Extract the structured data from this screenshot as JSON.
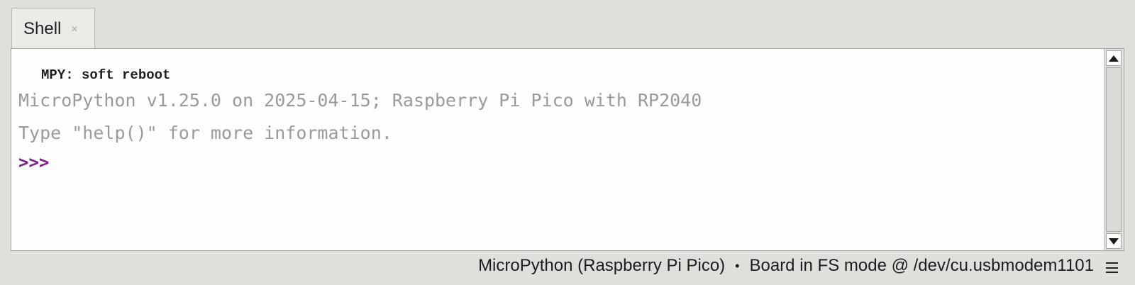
{
  "tabs": [
    {
      "label": "Shell",
      "close_glyph": "×",
      "active": true
    }
  ],
  "shell": {
    "lines": [
      "MPY: soft reboot",
      "MicroPython v1.25.0 on 2025-04-15; Raspberry Pi Pico with RP2040",
      "Type \"help()\" for more information."
    ],
    "prompt": ">>>"
  },
  "status": {
    "interpreter": "MicroPython (Raspberry Pi Pico)",
    "separator": "•",
    "connection": "Board in FS mode @ /dev/cu.usbmodem1101"
  },
  "icons": {
    "tab_close": "close-icon",
    "scroll_up": "arrow-up-icon",
    "scroll_down": "arrow-down-icon",
    "menu": "hamburger-menu-icon"
  },
  "colors": {
    "prompt": "#7a1f86",
    "info_text": "#9a9a9a",
    "background": "#e1dfdb",
    "shell_background": "#fdfdfd"
  }
}
